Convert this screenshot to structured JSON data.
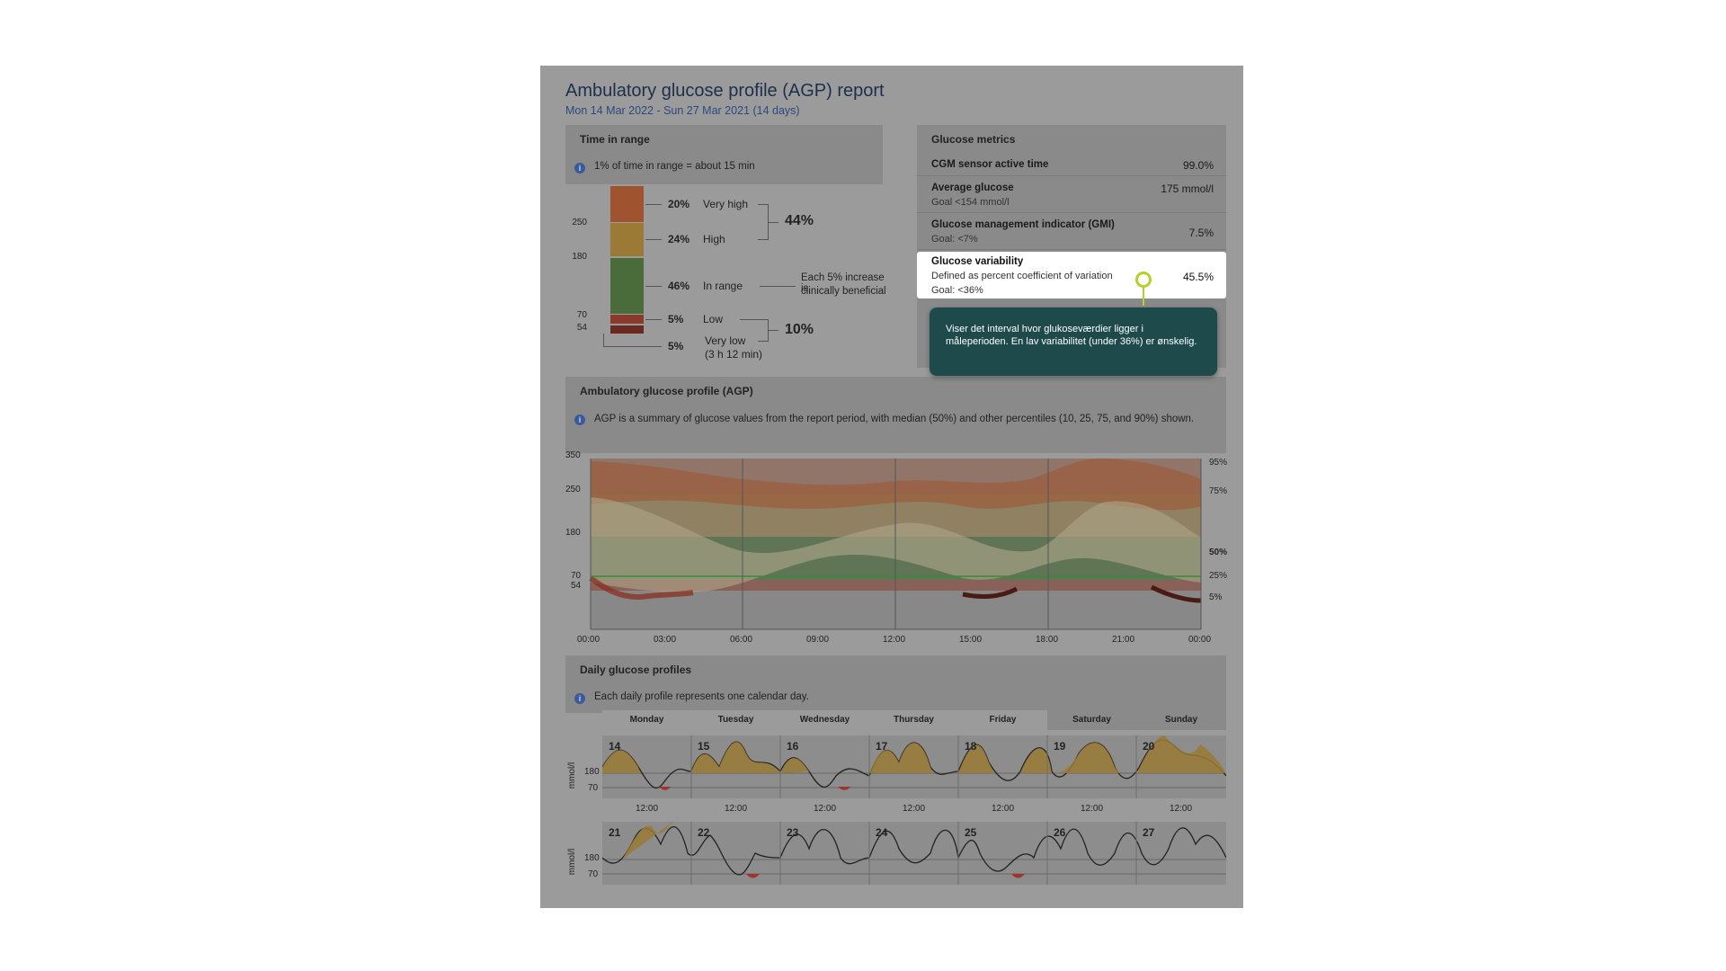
{
  "report": {
    "title": "Ambulatory glucose profile (AGP) report",
    "subtitle": "Mon 14 Mar 2022 - Sun 27 Mar 2021  (14 days)"
  },
  "time_in_range": {
    "title": "Time in range",
    "info": "1% of time in range = about 15 min",
    "ticks": [
      "250",
      "180",
      "70",
      "54"
    ],
    "rows": [
      {
        "pct": "20%",
        "label": "Very high"
      },
      {
        "pct": "24%",
        "label": "High"
      },
      {
        "pct": "46%",
        "label": "In range"
      },
      {
        "pct": "5%",
        "label": "Low"
      },
      {
        "pct": "5%",
        "label": "Very low"
      }
    ],
    "very_low_duration": "(3 h 12 min)",
    "high_total": "44%",
    "low_total": "10%",
    "in_range_note_1": "Each 5% increase is",
    "in_range_note_2": "clinically beneficial",
    "colors": {
      "very_high": "#a0532f",
      "high": "#9a7a35",
      "in_range": "#4a6b3a",
      "low": "#8a3a2a",
      "very_low": "#6a2a22"
    }
  },
  "metrics": {
    "title": "Glucose metrics",
    "rows": [
      {
        "name": "CGM sensor active time",
        "goal": "",
        "value": "99.0%"
      },
      {
        "name": "Average glucose",
        "goal": "Goal  <154 mmol/l",
        "value": "175 mmol/l"
      },
      {
        "name": "Glucose management indicator (GMI)",
        "goal": "Goal: <7%",
        "value": "7.5%"
      }
    ],
    "highlight": {
      "name": "Glucose variability",
      "definition": "Defined as percent coefficient of variation",
      "goal": "Goal: <36%",
      "value": "45.5%"
    }
  },
  "tooltip": {
    "text": "Viser det interval hvor glukoseværdier ligger i måleperioden. En lav variabilitet (under 36%) er ønskelig."
  },
  "agp": {
    "title": "Ambulatory glucose profile (AGP)",
    "info": "AGP is a summary of glucose values from the report period, with median (50%) and other percentiles (10, 25, 75, and 90%) shown.",
    "y_ticks": [
      "350",
      "250",
      "180",
      "70",
      "54"
    ],
    "x_ticks": [
      "00:00",
      "03:00",
      "06:00",
      "09:00",
      "12:00",
      "15:00",
      "18:00",
      "21:00",
      "00:00"
    ],
    "percentile_labels": [
      "95%",
      "75%",
      "50%",
      "25%",
      "5%"
    ]
  },
  "daily": {
    "title": "Daily glucose profiles",
    "info": "Each daily profile represents one calendar day.",
    "weekdays": [
      "Monday",
      "Tuesday",
      "Wednesday",
      "Thursday",
      "Friday",
      "Saturday",
      "Sunday"
    ],
    "week1": [
      "14",
      "15",
      "16",
      "17",
      "18",
      "19",
      "20"
    ],
    "week2": [
      "21",
      "22",
      "23",
      "24",
      "25",
      "26",
      "27"
    ],
    "noon_label": "12:00",
    "unit": "mmol/l",
    "y_ticks": [
      "180",
      "70"
    ]
  }
}
